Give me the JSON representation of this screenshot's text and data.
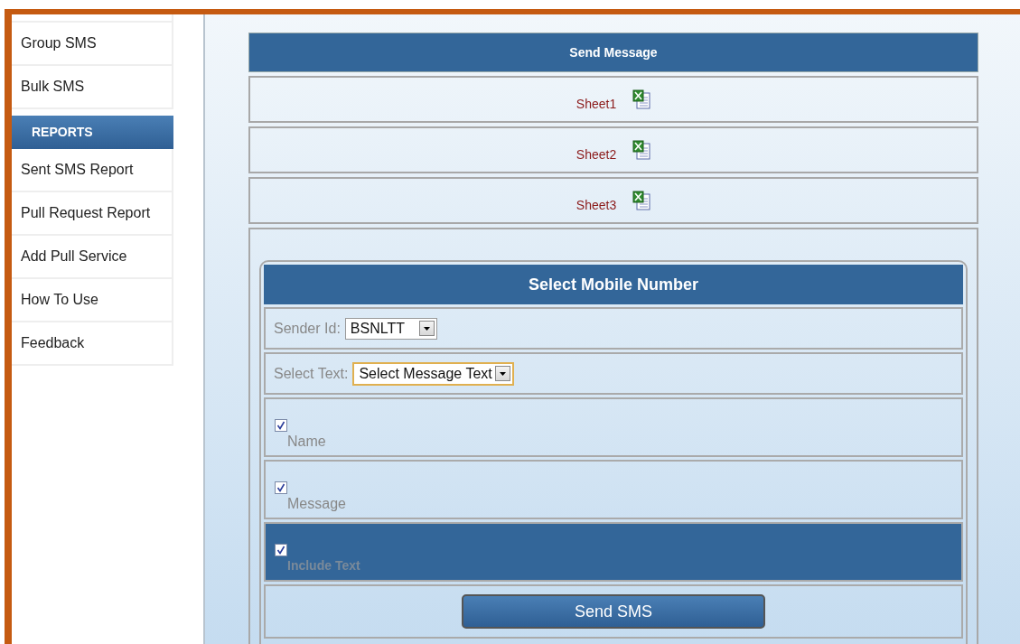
{
  "sidebar": {
    "items": [
      {
        "label": "Group SMS",
        "kind": "link"
      },
      {
        "label": "Bulk SMS",
        "kind": "link"
      },
      {
        "label": "REPORTS",
        "kind": "header"
      },
      {
        "label": "Sent SMS Report",
        "kind": "link"
      },
      {
        "label": "Pull Request Report",
        "kind": "link"
      },
      {
        "label": "Add Pull Service",
        "kind": "link"
      },
      {
        "label": "How To Use",
        "kind": "link"
      },
      {
        "label": "Feedback",
        "kind": "link"
      }
    ]
  },
  "send_message": {
    "title": "Send Message",
    "sheets": [
      "Sheet1",
      "Sheet2",
      "Sheet3"
    ]
  },
  "form": {
    "title": "Select Mobile Number",
    "sender_id": {
      "label": "Sender Id:",
      "value": "BSNLTT"
    },
    "select_text": {
      "label": "Select Text:",
      "value": "Select Message Text",
      "focused": true
    },
    "options": [
      {
        "label": "Name",
        "checked": true,
        "selected": false
      },
      {
        "label": "Message",
        "checked": true,
        "selected": false
      },
      {
        "label": "Include Text",
        "checked": true,
        "selected": true
      }
    ],
    "submit": "Send SMS"
  }
}
